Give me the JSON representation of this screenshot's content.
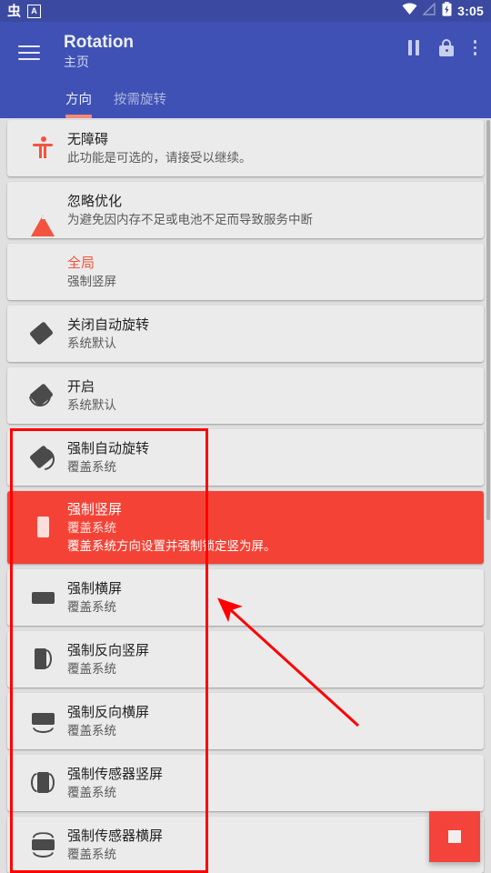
{
  "statusbar": {
    "left_icons": [
      "bug-glyph-icon",
      "a-badge-icon"
    ],
    "left_glyph": "虫",
    "left_badge": "A",
    "right_icons": [
      "wifi-icon",
      "signal-off-icon",
      "battery-charging-icon"
    ],
    "clock": "3:05"
  },
  "appbar": {
    "menu_icon": "hamburger-icon",
    "title": "Rotation",
    "subtitle": "主页",
    "actions": [
      "pause-icon",
      "lock-icon",
      "overflow-menu-icon"
    ],
    "accent": "#3f51b5",
    "tabs": [
      {
        "label": "方向",
        "active": true
      },
      {
        "label": "按需旋转",
        "active": false
      }
    ]
  },
  "list": {
    "items": [
      {
        "icon": "accessibility-icon",
        "title": "无障碍",
        "subtitle": "此功能是可选的，请接受以继续。",
        "description": "",
        "highlight": false
      },
      {
        "icon": "warning-triangle-icon",
        "title": "忽略优化",
        "subtitle": "为避免因内存不足或电池不足而导致服务中断",
        "description": "",
        "highlight": false
      },
      {
        "icon": "none",
        "title": "全局",
        "subtitle": "强制竖屏",
        "description": "",
        "highlight": false,
        "title_accent": true
      },
      {
        "icon": "rotate-off-icon",
        "title": "关闭自动旋转",
        "subtitle": "系统默认",
        "description": "",
        "highlight": false
      },
      {
        "icon": "rotate-on-icon",
        "title": "开启",
        "subtitle": "系统默认",
        "description": "",
        "highlight": false
      },
      {
        "icon": "rotate-force-icon",
        "title": "强制自动旋转",
        "subtitle": "覆盖系统",
        "description": "",
        "highlight": false
      },
      {
        "icon": "portrait-icon",
        "title": "强制竖屏",
        "subtitle": "覆盖系统",
        "description": "覆盖系统方向设置并强制锁定竖为屏。",
        "highlight": true
      },
      {
        "icon": "landscape-icon",
        "title": "强制横屏",
        "subtitle": "覆盖系统",
        "description": "",
        "highlight": false
      },
      {
        "icon": "reverse-portrait-icon",
        "title": "强制反向竖屏",
        "subtitle": "覆盖系统",
        "description": "",
        "highlight": false
      },
      {
        "icon": "reverse-landscape-icon",
        "title": "强制反向横屏",
        "subtitle": "覆盖系统",
        "description": "",
        "highlight": false
      },
      {
        "icon": "sensor-portrait-icon",
        "title": "强制传感器竖屏",
        "subtitle": "覆盖系统",
        "description": "",
        "highlight": false
      },
      {
        "icon": "sensor-landscape-icon",
        "title": "强制传感器横屏",
        "subtitle": "覆盖系统",
        "description": "",
        "highlight": false
      }
    ]
  },
  "fab": {
    "icon": "stop-square-icon",
    "color": "#f4433a"
  },
  "annotations": {
    "box_color": "#ff0000",
    "arrow_color": "#ff0000"
  }
}
